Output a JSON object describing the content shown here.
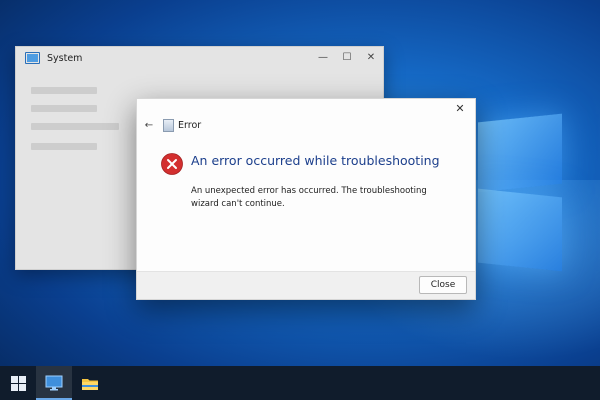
{
  "background_window": {
    "title": "System",
    "controls": {
      "minimize": "—",
      "maximize": "☐",
      "close": "✕"
    }
  },
  "dialog": {
    "header_label": "Error",
    "title": "An error occurred while troubleshooting",
    "message": "An unexpected error has occurred. The troubleshooting wizard can't continue.",
    "close_button_label": "Close",
    "close_glyph": "✕",
    "back_glyph": "←"
  },
  "icons": {
    "error": "error-circle-x-icon",
    "window_app": "monitor-icon",
    "dialog_header": "troubleshooter-icon",
    "start": "windows-logo-icon",
    "taskbar_app": "monitor-icon",
    "explorer": "folder-icon"
  },
  "colors": {
    "error_red": "#d32f2f",
    "title_blue": "#1c3f8c",
    "taskbar": "#101c2c"
  }
}
